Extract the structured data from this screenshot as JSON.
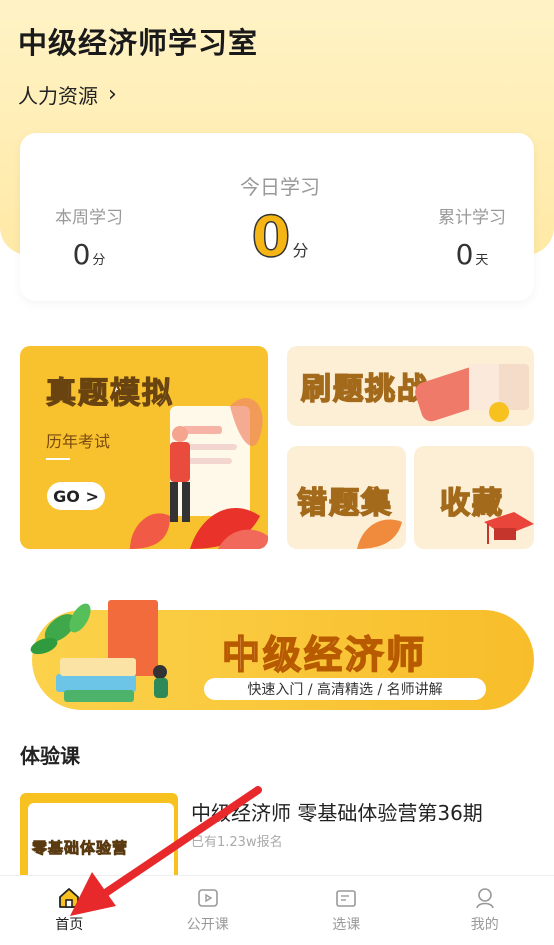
{
  "header": {
    "title": "中级经济师学习室",
    "subject": "人力资源"
  },
  "stats": {
    "week": {
      "label": "本周学习",
      "value": "0",
      "unit": "分"
    },
    "today": {
      "label": "今日学习",
      "value": "0",
      "unit": "分"
    },
    "total": {
      "label": "累计学习",
      "value": "0",
      "unit": "天"
    }
  },
  "cards": {
    "mock": {
      "title": "真题模拟",
      "subtitle": "历年考试",
      "button": "GO >"
    },
    "challenge": {
      "title": "刷题挑战"
    },
    "mistakes": {
      "title": "错题集"
    },
    "favorites": {
      "title": "收藏"
    }
  },
  "banner": {
    "title": "中级经济师",
    "tagline": "快速入门 / 高清精选 / 名师讲解"
  },
  "trial": {
    "section_title": "体验课",
    "course": {
      "title": "中级经济师 零基础体验营第36期",
      "meta": "已有1.23w报名",
      "thumb_text": "零基础体验营"
    }
  },
  "tabs": [
    {
      "label": "首页",
      "icon": "home-icon",
      "active": true
    },
    {
      "label": "公开课",
      "icon": "video-icon",
      "active": false
    },
    {
      "label": "选课",
      "icon": "course-list-icon",
      "active": false
    },
    {
      "label": "我的",
      "icon": "profile-icon",
      "active": false
    }
  ],
  "colors": {
    "accent": "#f8c12e",
    "pale_card": "#fdefd5",
    "header_bg": "#ffeeb3",
    "arrow": "#e8292b"
  }
}
